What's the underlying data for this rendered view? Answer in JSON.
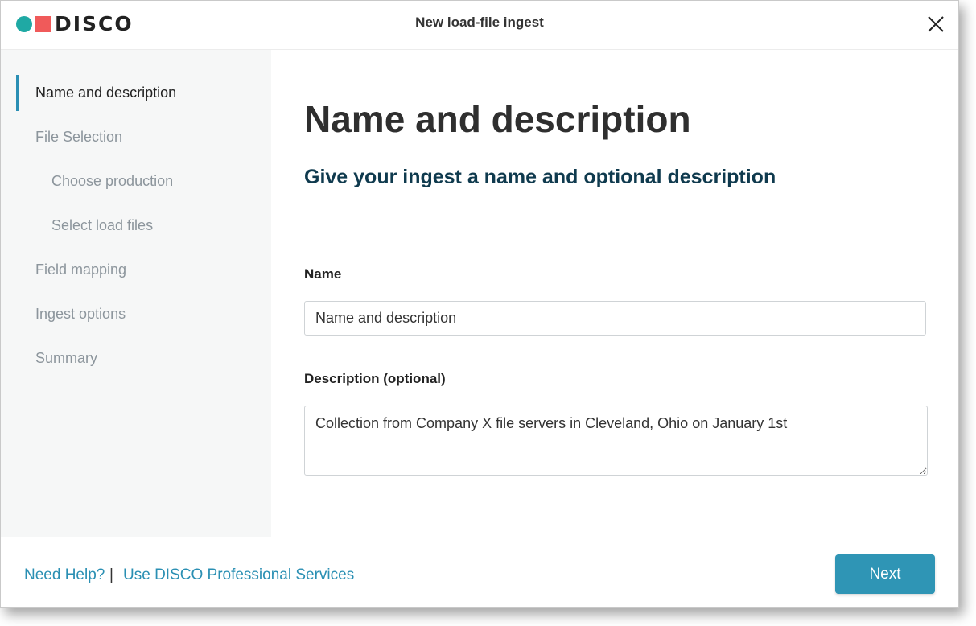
{
  "header": {
    "brand": "DISCO",
    "title": "New load-file ingest",
    "close_icon": "close-icon"
  },
  "sidebar": {
    "items": [
      {
        "label": "Name and description",
        "active": true
      },
      {
        "label": "File Selection",
        "active": false
      },
      {
        "label": "Choose production",
        "active": false
      },
      {
        "label": "Select load files",
        "active": false
      },
      {
        "label": "Field mapping",
        "active": false
      },
      {
        "label": "Ingest options",
        "active": false
      },
      {
        "label": "Summary",
        "active": false
      }
    ]
  },
  "main": {
    "title": "Name and description",
    "subtitle": "Give your ingest a name and optional description",
    "name_label": "Name",
    "name_value": "Name and description",
    "description_label": "Description (optional)",
    "description_value": "Collection from Company X file servers in Cleveland, Ohio on January 1st"
  },
  "footer": {
    "help_link": "Need Help?",
    "separator": "|",
    "services_link": "Use DISCO Professional Services",
    "next_label": "Next"
  },
  "colors": {
    "accent": "#2f95b5",
    "brand_teal": "#1fa9a4",
    "brand_coral": "#f05a5a",
    "link": "#2a8fb3"
  }
}
